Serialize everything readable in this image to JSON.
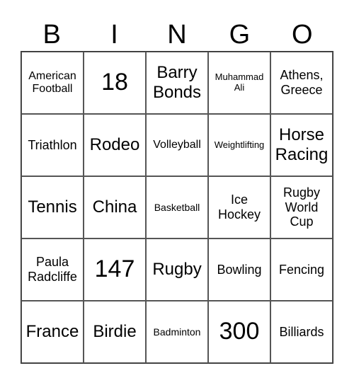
{
  "header": [
    "B",
    "I",
    "N",
    "G",
    "O"
  ],
  "cells": [
    "American Football",
    "18",
    "Barry Bonds",
    "Muhammad Ali",
    "Athens, Greece",
    "Triathlon",
    "Rodeo",
    "Volleyball",
    "Weightlifting",
    "Horse Racing",
    "Tennis",
    "China",
    "Basketball",
    "Ice Hockey",
    "Rugby World Cup",
    "Paula Radcliffe",
    "147",
    "Rugby",
    "Bowling",
    "Fencing",
    "France",
    "Birdie",
    "Badminton",
    "300",
    "Billiards"
  ]
}
